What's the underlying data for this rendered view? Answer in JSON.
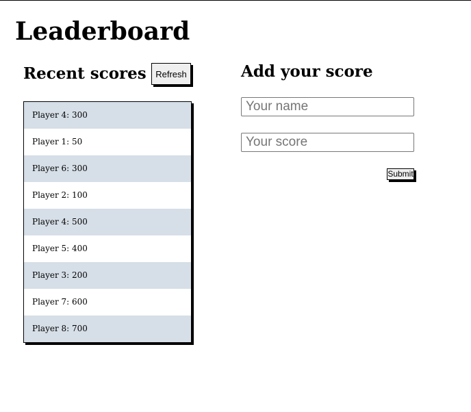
{
  "page": {
    "title": "Leaderboard"
  },
  "recent": {
    "title": "Recent scores",
    "refresh_label": "Refresh",
    "items": [
      "Player 4: 300",
      "Player 1: 50",
      "Player 6: 300",
      "Player 2: 100",
      "Player 4: 500",
      "Player 5: 400",
      "Player 3: 200",
      "Player 7: 600",
      "Player 8: 700"
    ]
  },
  "form": {
    "title": "Add your score",
    "name_placeholder": "Your name",
    "name_value": "",
    "score_placeholder": "Your score",
    "score_value": "",
    "submit_label": "Submit"
  },
  "colors": {
    "row_shade": "#d6dee7",
    "border": "#000000"
  }
}
